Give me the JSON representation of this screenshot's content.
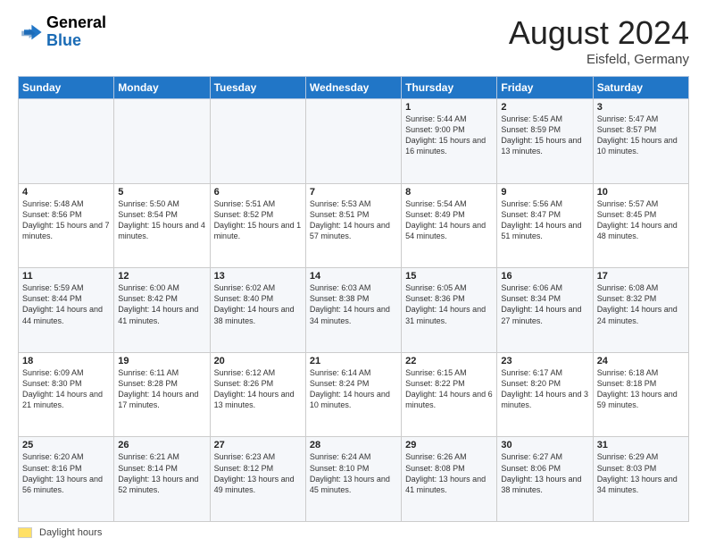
{
  "header": {
    "logo_general": "General",
    "logo_blue": "Blue",
    "title": "August 2024",
    "location": "Eisfeld, Germany"
  },
  "footer": {
    "daylight_label": "Daylight hours"
  },
  "days_of_week": [
    "Sunday",
    "Monday",
    "Tuesday",
    "Wednesday",
    "Thursday",
    "Friday",
    "Saturday"
  ],
  "weeks": [
    [
      {
        "day": "",
        "info": ""
      },
      {
        "day": "",
        "info": ""
      },
      {
        "day": "",
        "info": ""
      },
      {
        "day": "",
        "info": ""
      },
      {
        "day": "1",
        "info": "Sunrise: 5:44 AM\nSunset: 9:00 PM\nDaylight: 15 hours\nand 16 minutes."
      },
      {
        "day": "2",
        "info": "Sunrise: 5:45 AM\nSunset: 8:59 PM\nDaylight: 15 hours\nand 13 minutes."
      },
      {
        "day": "3",
        "info": "Sunrise: 5:47 AM\nSunset: 8:57 PM\nDaylight: 15 hours\nand 10 minutes."
      }
    ],
    [
      {
        "day": "4",
        "info": "Sunrise: 5:48 AM\nSunset: 8:56 PM\nDaylight: 15 hours\nand 7 minutes."
      },
      {
        "day": "5",
        "info": "Sunrise: 5:50 AM\nSunset: 8:54 PM\nDaylight: 15 hours\nand 4 minutes."
      },
      {
        "day": "6",
        "info": "Sunrise: 5:51 AM\nSunset: 8:52 PM\nDaylight: 15 hours\nand 1 minute."
      },
      {
        "day": "7",
        "info": "Sunrise: 5:53 AM\nSunset: 8:51 PM\nDaylight: 14 hours\nand 57 minutes."
      },
      {
        "day": "8",
        "info": "Sunrise: 5:54 AM\nSunset: 8:49 PM\nDaylight: 14 hours\nand 54 minutes."
      },
      {
        "day": "9",
        "info": "Sunrise: 5:56 AM\nSunset: 8:47 PM\nDaylight: 14 hours\nand 51 minutes."
      },
      {
        "day": "10",
        "info": "Sunrise: 5:57 AM\nSunset: 8:45 PM\nDaylight: 14 hours\nand 48 minutes."
      }
    ],
    [
      {
        "day": "11",
        "info": "Sunrise: 5:59 AM\nSunset: 8:44 PM\nDaylight: 14 hours\nand 44 minutes."
      },
      {
        "day": "12",
        "info": "Sunrise: 6:00 AM\nSunset: 8:42 PM\nDaylight: 14 hours\nand 41 minutes."
      },
      {
        "day": "13",
        "info": "Sunrise: 6:02 AM\nSunset: 8:40 PM\nDaylight: 14 hours\nand 38 minutes."
      },
      {
        "day": "14",
        "info": "Sunrise: 6:03 AM\nSunset: 8:38 PM\nDaylight: 14 hours\nand 34 minutes."
      },
      {
        "day": "15",
        "info": "Sunrise: 6:05 AM\nSunset: 8:36 PM\nDaylight: 14 hours\nand 31 minutes."
      },
      {
        "day": "16",
        "info": "Sunrise: 6:06 AM\nSunset: 8:34 PM\nDaylight: 14 hours\nand 27 minutes."
      },
      {
        "day": "17",
        "info": "Sunrise: 6:08 AM\nSunset: 8:32 PM\nDaylight: 14 hours\nand 24 minutes."
      }
    ],
    [
      {
        "day": "18",
        "info": "Sunrise: 6:09 AM\nSunset: 8:30 PM\nDaylight: 14 hours\nand 21 minutes."
      },
      {
        "day": "19",
        "info": "Sunrise: 6:11 AM\nSunset: 8:28 PM\nDaylight: 14 hours\nand 17 minutes."
      },
      {
        "day": "20",
        "info": "Sunrise: 6:12 AM\nSunset: 8:26 PM\nDaylight: 14 hours\nand 13 minutes."
      },
      {
        "day": "21",
        "info": "Sunrise: 6:14 AM\nSunset: 8:24 PM\nDaylight: 14 hours\nand 10 minutes."
      },
      {
        "day": "22",
        "info": "Sunrise: 6:15 AM\nSunset: 8:22 PM\nDaylight: 14 hours\nand 6 minutes."
      },
      {
        "day": "23",
        "info": "Sunrise: 6:17 AM\nSunset: 8:20 PM\nDaylight: 14 hours\nand 3 minutes."
      },
      {
        "day": "24",
        "info": "Sunrise: 6:18 AM\nSunset: 8:18 PM\nDaylight: 13 hours\nand 59 minutes."
      }
    ],
    [
      {
        "day": "25",
        "info": "Sunrise: 6:20 AM\nSunset: 8:16 PM\nDaylight: 13 hours\nand 56 minutes."
      },
      {
        "day": "26",
        "info": "Sunrise: 6:21 AM\nSunset: 8:14 PM\nDaylight: 13 hours\nand 52 minutes."
      },
      {
        "day": "27",
        "info": "Sunrise: 6:23 AM\nSunset: 8:12 PM\nDaylight: 13 hours\nand 49 minutes."
      },
      {
        "day": "28",
        "info": "Sunrise: 6:24 AM\nSunset: 8:10 PM\nDaylight: 13 hours\nand 45 minutes."
      },
      {
        "day": "29",
        "info": "Sunrise: 6:26 AM\nSunset: 8:08 PM\nDaylight: 13 hours\nand 41 minutes."
      },
      {
        "day": "30",
        "info": "Sunrise: 6:27 AM\nSunset: 8:06 PM\nDaylight: 13 hours\nand 38 minutes."
      },
      {
        "day": "31",
        "info": "Sunrise: 6:29 AM\nSunset: 8:03 PM\nDaylight: 13 hours\nand 34 minutes."
      }
    ]
  ]
}
